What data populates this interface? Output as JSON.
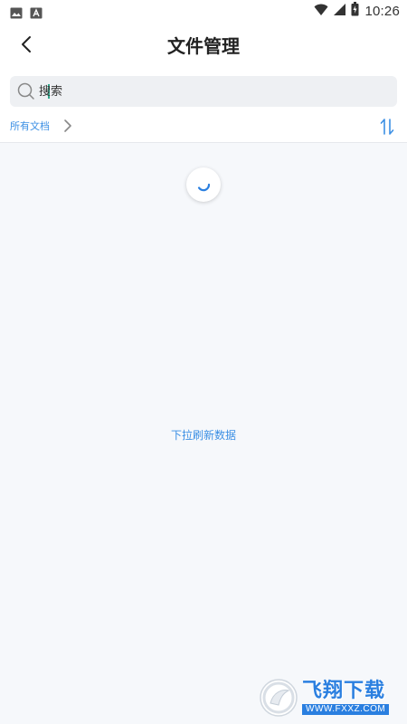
{
  "status_bar": {
    "time": "10:26",
    "icons": [
      "image-icon",
      "text-a-icon",
      "wifi-icon",
      "signal-icon",
      "battery-icon"
    ]
  },
  "header": {
    "title": "文件管理",
    "back_icon": "chevron-left-icon"
  },
  "search": {
    "placeholder": "搜索",
    "value": "",
    "icon": "search-icon"
  },
  "breadcrumb": {
    "items": [
      "所有文档"
    ],
    "chevron_icon": "chevron-right-icon",
    "sort_icon": "sort-arrows-icon"
  },
  "content": {
    "loading": true,
    "message": "下拉刷新数据"
  },
  "watermark": {
    "brand": "飞翔下载",
    "url": "WWW.FXXZ.COM"
  },
  "colors": {
    "accent": "#3b8fe4",
    "background": "#f6f8fb",
    "search_bg": "#eef0f3",
    "caret": "#2ea68a",
    "watermark_blue": "#2a7fe0"
  }
}
